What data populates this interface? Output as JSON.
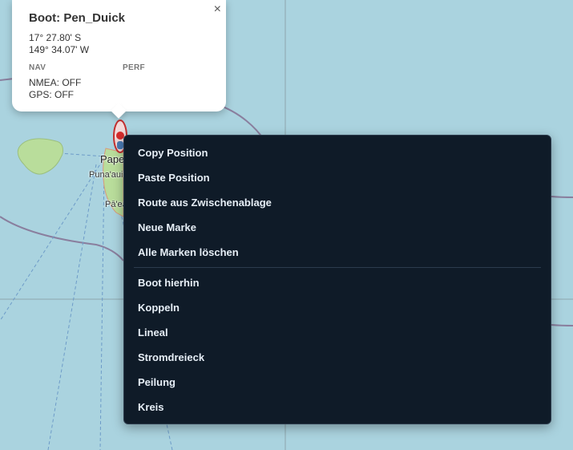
{
  "map": {
    "labels": {
      "city": "Pape",
      "town1": "Puna'aui'",
      "town2": "Pā'ea"
    }
  },
  "popup": {
    "title": "Boot: Pen_Duick",
    "close_icon": "×",
    "lat": "17° 27.80' S",
    "lon": "149° 34.07' W",
    "section_nav": "NAV",
    "section_perf": "PERF",
    "nmea": "NMEA: OFF",
    "gps": "GPS: OFF"
  },
  "boat_marker": {
    "icon": "boat-marker-icon",
    "color": "#d62c2c"
  },
  "context_menu": {
    "group1": [
      "Copy Position",
      "Paste Position",
      "Route aus Zwischenablage",
      "Neue Marke",
      "Alle Marken löschen"
    ],
    "group2": [
      "Boot hierhin",
      "Koppeln",
      "Lineal",
      "Stromdreieck",
      "Peilung",
      "Kreis"
    ]
  },
  "colors": {
    "water": "#aad3df",
    "land": "#b9dd9b",
    "menu_bg": "#0f1b28",
    "eez_line": "#8a7f9e"
  }
}
